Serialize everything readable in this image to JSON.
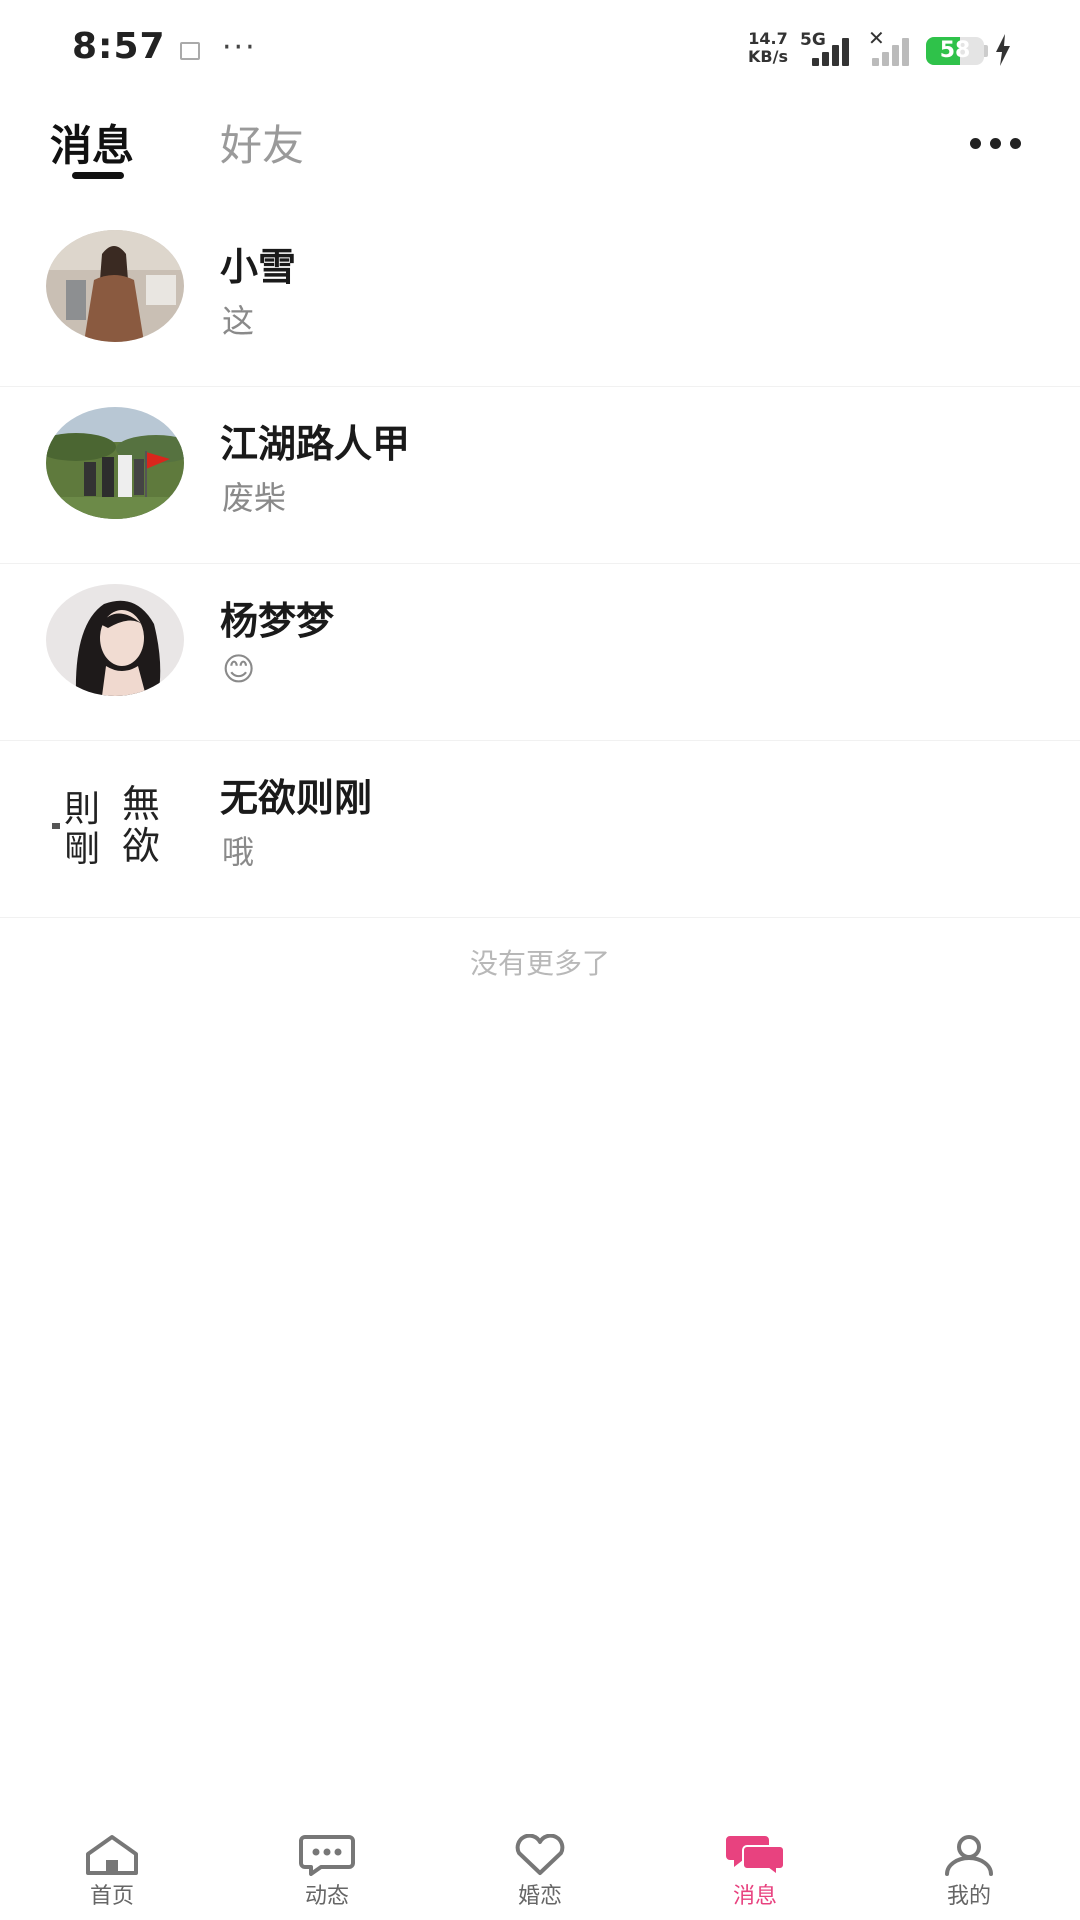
{
  "status_bar": {
    "time": "8:57",
    "more": "···",
    "speed_top": "14.7",
    "speed_bottom": "KB/s",
    "network": "5G",
    "battery_level": "58",
    "battery_fraction": 0.58,
    "battery_color": "#2fc24a"
  },
  "header": {
    "tabs": [
      {
        "label": "消息",
        "active": true
      },
      {
        "label": "好友",
        "active": false
      }
    ]
  },
  "conversations": [
    {
      "name": "小雪",
      "preview": "这",
      "avatar_icon": "woman-in-brown-dress-photo"
    },
    {
      "name": "江湖路人甲",
      "preview": "废柴",
      "avatar_icon": "outdoor-group-flag-photo"
    },
    {
      "name": "杨梦梦",
      "preview": "😊",
      "avatar_icon": "woman-portrait-photo"
    },
    {
      "name": "无欲则刚",
      "preview": "哦",
      "avatar_icon": "calligraphy-photo",
      "avatar_text": "無欲 則剛"
    }
  ],
  "list_footer": "没有更多了",
  "bottom_nav": [
    {
      "label": "首页",
      "icon": "home-icon",
      "active": false
    },
    {
      "label": "动态",
      "icon": "chat-bubble-icon",
      "active": false
    },
    {
      "label": "婚恋",
      "icon": "heart-icon",
      "active": false
    },
    {
      "label": "消息",
      "icon": "messages-icon",
      "active": true
    },
    {
      "label": "我的",
      "icon": "profile-icon",
      "active": false
    }
  ],
  "colors": {
    "accent": "#e8427f",
    "inactive_icon": "#777777"
  }
}
